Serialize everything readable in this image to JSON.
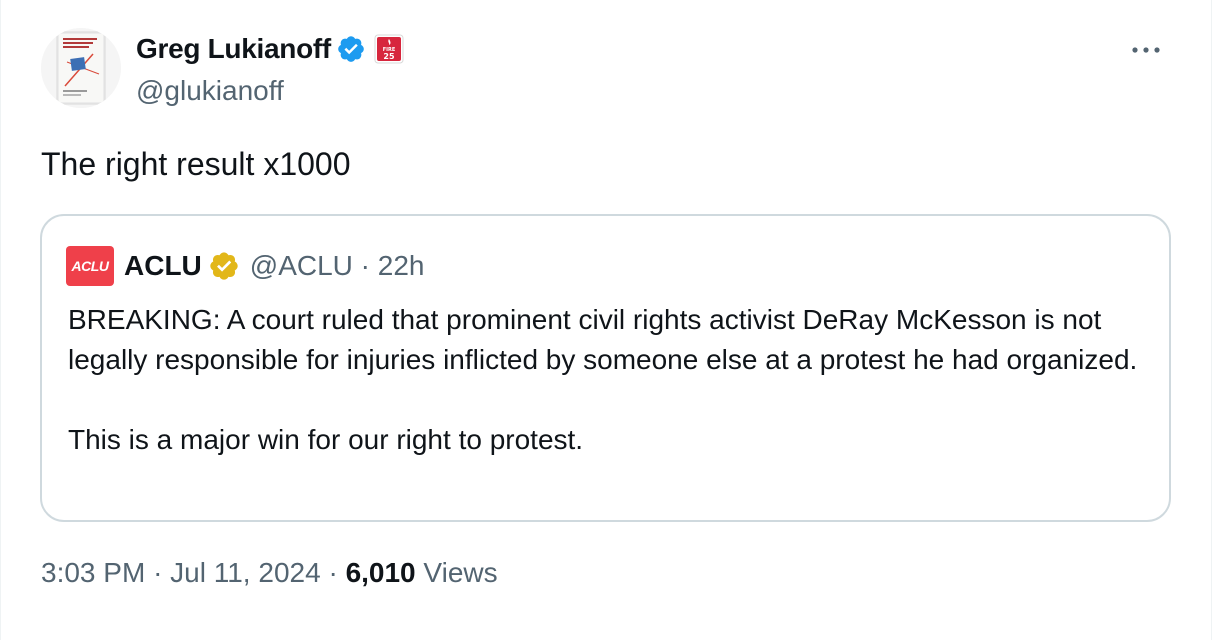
{
  "author": {
    "display_name": "Greg Lukianoff",
    "handle": "@glukianoff",
    "avatar_icon": "book-cover-avatar",
    "verified_color": "#1d9bf0",
    "affiliate_badge_text": [
      "FIRE",
      "25"
    ]
  },
  "tweet": {
    "text": "The right result x1000"
  },
  "quoted": {
    "avatar_text": "ACLU",
    "display_name": "ACLU",
    "handle": "@ACLU",
    "separator": "·",
    "time_ago": "22h",
    "verified_color": "#e2b719",
    "paragraphs": [
      "BREAKING: A court ruled that prominent civil rights activist DeRay McKesson is not legally responsible for injuries inflicted by someone else at a protest he had organized.",
      "This is a major win for our right to protest."
    ]
  },
  "meta": {
    "time": "3:03 PM",
    "separator": "·",
    "date": "Jul 11, 2024",
    "views_count": "6,010",
    "views_label": "Views"
  },
  "colors": {
    "text_primary": "#0f1419",
    "text_secondary": "#536471",
    "border": "#cfd9de",
    "aclu_red": "#ef404a"
  }
}
